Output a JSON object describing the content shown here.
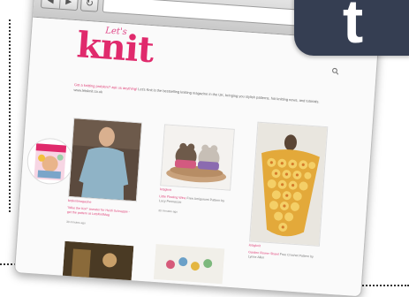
{
  "fragment_text": "g",
  "browser": {
    "nav_back": "◀",
    "nav_forward": "▶",
    "reload": "↻",
    "address": ""
  },
  "site": {
    "logo_script": "Let's",
    "logo_main": "knit",
    "intro_pink": "Got a knitting problem? ask us anything!",
    "intro_rest": "Let's Knit is the bestselling knitting magazine in the UK, bringing you stylish patterns, hot knitting news, and tutorials. www.letsknit.co.uk"
  },
  "cards": [
    {
      "label": "letsknitmagazine",
      "caption_pink": "\"Mike the Kori\" sweater for Heidi Schnappe - get the pattern at LetsKnitMag",
      "meta": "30 minutes ago"
    },
    {
      "label": "letsgknit",
      "caption_pink": "Little Flowing Wine",
      "caption_grey": "Free Amigurumi Pattern by Lucy Pennaccio",
      "meta": "30 minutes ago"
    },
    {
      "label": "letsgknit",
      "caption_pink": "Garden Flower Shawl",
      "caption_grey": "Free Crochet Pattern by Lynne Allen",
      "meta": ""
    }
  ],
  "colors": {
    "brand_pink": "#e02a6c",
    "badge": "#353e52"
  },
  "icons": {
    "badge": "tumblr-t-icon",
    "search": "search-icon"
  },
  "badge_letter": "t"
}
